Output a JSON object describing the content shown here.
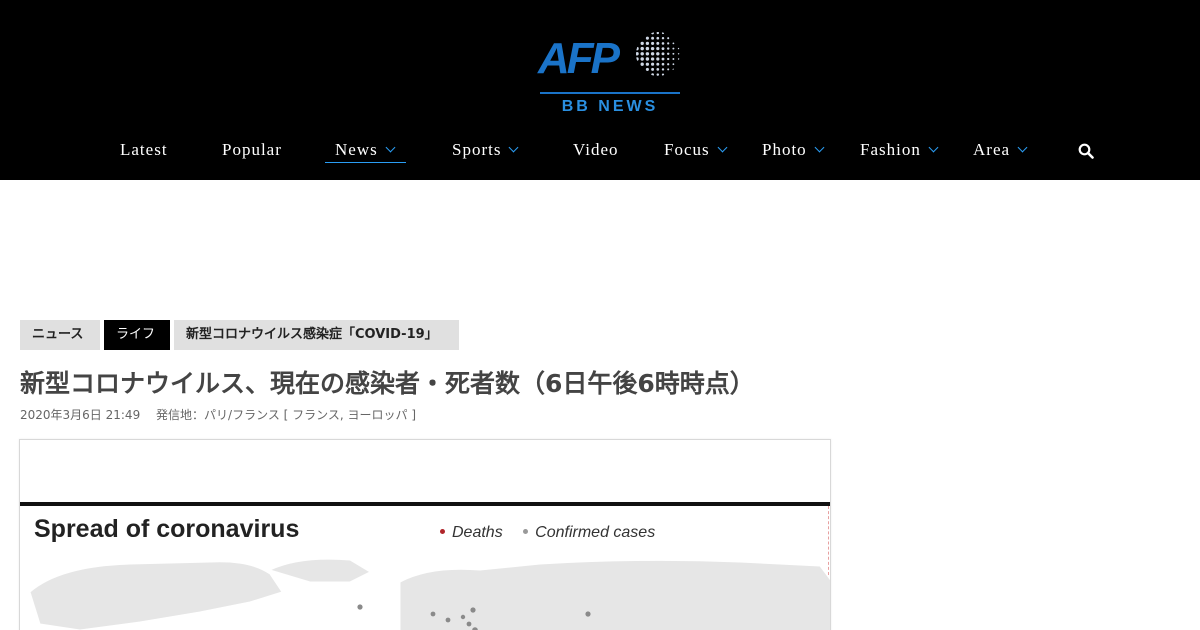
{
  "header": {
    "logo_text": "AFP",
    "logo_sub": "BB NEWS"
  },
  "nav": {
    "items": [
      {
        "label": "Latest",
        "has_dropdown": false,
        "active": false
      },
      {
        "label": "Popular",
        "has_dropdown": false,
        "active": false
      },
      {
        "label": "News",
        "has_dropdown": true,
        "active": true
      },
      {
        "label": "Sports",
        "has_dropdown": true,
        "active": false
      },
      {
        "label": "Video",
        "has_dropdown": false,
        "active": false
      },
      {
        "label": "Focus",
        "has_dropdown": true,
        "active": false
      },
      {
        "label": "Photo",
        "has_dropdown": true,
        "active": false
      },
      {
        "label": "Fashion",
        "has_dropdown": true,
        "active": false
      },
      {
        "label": "Area",
        "has_dropdown": true,
        "active": false
      }
    ],
    "search_icon": "search-icon"
  },
  "tags": [
    "ニュース",
    "ライフ",
    "新型コロナウイルス感染症「COVID-19」"
  ],
  "article": {
    "title": "新型コロナウイルス、現在の感染者・死者数（6日午後6時時点）",
    "date": "2020年3月6日 21:49",
    "origin": "発信地：パリ/フランス [ フランス, ヨーロッパ ]"
  },
  "figure": {
    "title": "Spread of coronavirus",
    "legend": [
      {
        "label": "Deaths",
        "color": "#b0252a"
      },
      {
        "label": "Confirmed cases",
        "color": "#999999"
      }
    ]
  },
  "colors": {
    "accent": "#2a9df4",
    "header_bg": "#000000",
    "logo_blue": "#1a73c8"
  }
}
